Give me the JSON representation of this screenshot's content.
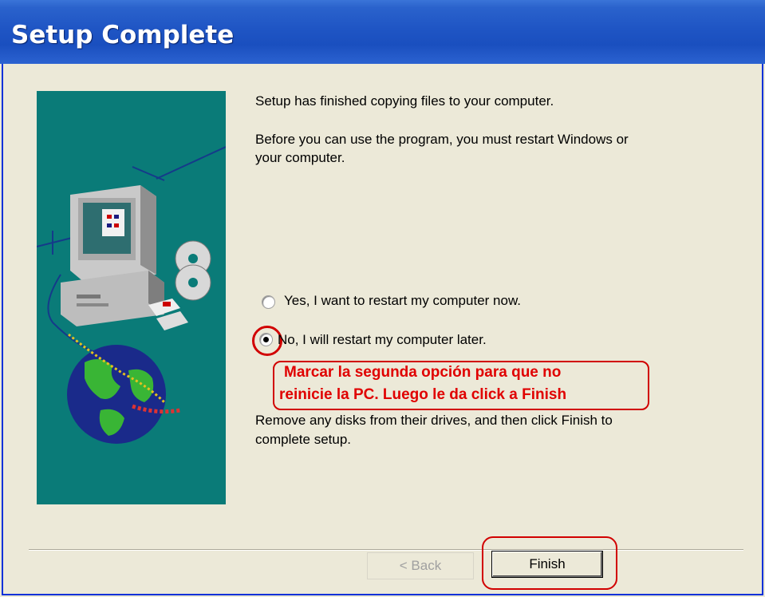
{
  "window": {
    "title": "Setup Complete"
  },
  "main": {
    "line1": "Setup has finished copying files to your computer.",
    "line2a": "Before you can use the program, you must restart Windows or",
    "line2b": "your computer.",
    "options": [
      {
        "label": "Yes, I want to restart my computer now.",
        "selected": false
      },
      {
        "label": "No, I will restart my computer later.",
        "selected": true
      }
    ],
    "annotation_line1": "Marcar la segunda opción para que no",
    "annotation_line2": "reinicie la PC. Luego le da click a Finish",
    "footer_a": "Remove any disks from their drives, and then click Finish to",
    "footer_b": "complete setup."
  },
  "buttons": {
    "back": "< Back",
    "finish": "Finish"
  },
  "colors": {
    "accent": "#1f55c4",
    "annotation": "#e00000",
    "panel": "#0a7b78"
  }
}
